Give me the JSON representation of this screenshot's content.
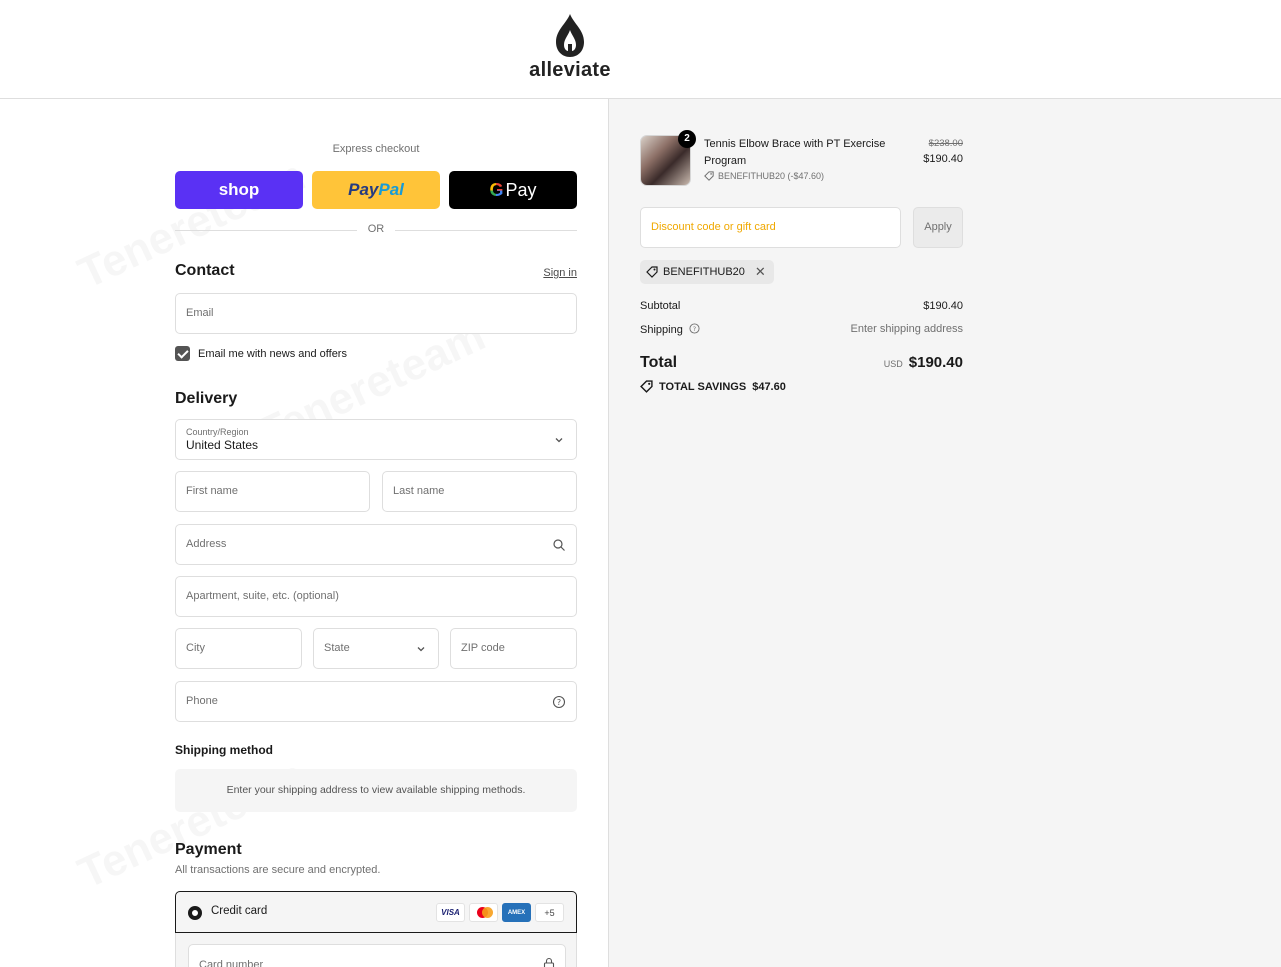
{
  "brand": {
    "name": "alleviate"
  },
  "watermark": "Tenereteam",
  "express": {
    "label": "Express checkout",
    "buttons": {
      "shop": "shop",
      "paypal_a": "Pay",
      "paypal_b": "Pal",
      "gpay_g": "G",
      "gpay_text": "Pay"
    },
    "or": "OR"
  },
  "contact": {
    "heading": "Contact",
    "sign_in": "Sign in",
    "email_placeholder": "Email",
    "newsletter": "Email me with news and offers",
    "newsletter_checked": true
  },
  "delivery": {
    "heading": "Delivery",
    "country_label": "Country/Region",
    "country_value": "United States",
    "first_name": "First name",
    "last_name": "Last name",
    "address": "Address",
    "apartment": "Apartment, suite, etc. (optional)",
    "city": "City",
    "state": "State",
    "zip": "ZIP code",
    "phone": "Phone"
  },
  "shipping_method": {
    "heading": "Shipping method",
    "message": "Enter your shipping address to view available shipping methods."
  },
  "payment": {
    "heading": "Payment",
    "subtitle": "All transactions are secure and encrypted.",
    "method": "Credit card",
    "cards": [
      "VISA",
      "AMEX",
      "+5"
    ],
    "card_number": "Card number"
  },
  "summary": {
    "item": {
      "quantity": "2",
      "title": "Tennis Elbow Brace with PT Exercise Program",
      "discount": "BENEFITHUB20 (-$47.60)",
      "price_original": "$238.00",
      "price": "$190.40"
    },
    "discount_placeholder": "Discount code or gift card",
    "apply": "Apply",
    "applied_code": "BENEFITHUB20",
    "subtotal_label": "Subtotal",
    "subtotal": "$190.40",
    "shipping_label": "Shipping",
    "shipping_value": "Enter shipping address",
    "total_label": "Total",
    "currency": "USD",
    "total": "$190.40",
    "savings_label": "TOTAL SAVINGS",
    "savings": "$47.60"
  },
  "colors": {
    "shop": "#5a31f4",
    "paypal": "#ffc439",
    "gpay": "#000000",
    "discount_placeholder": "#f0a800"
  }
}
